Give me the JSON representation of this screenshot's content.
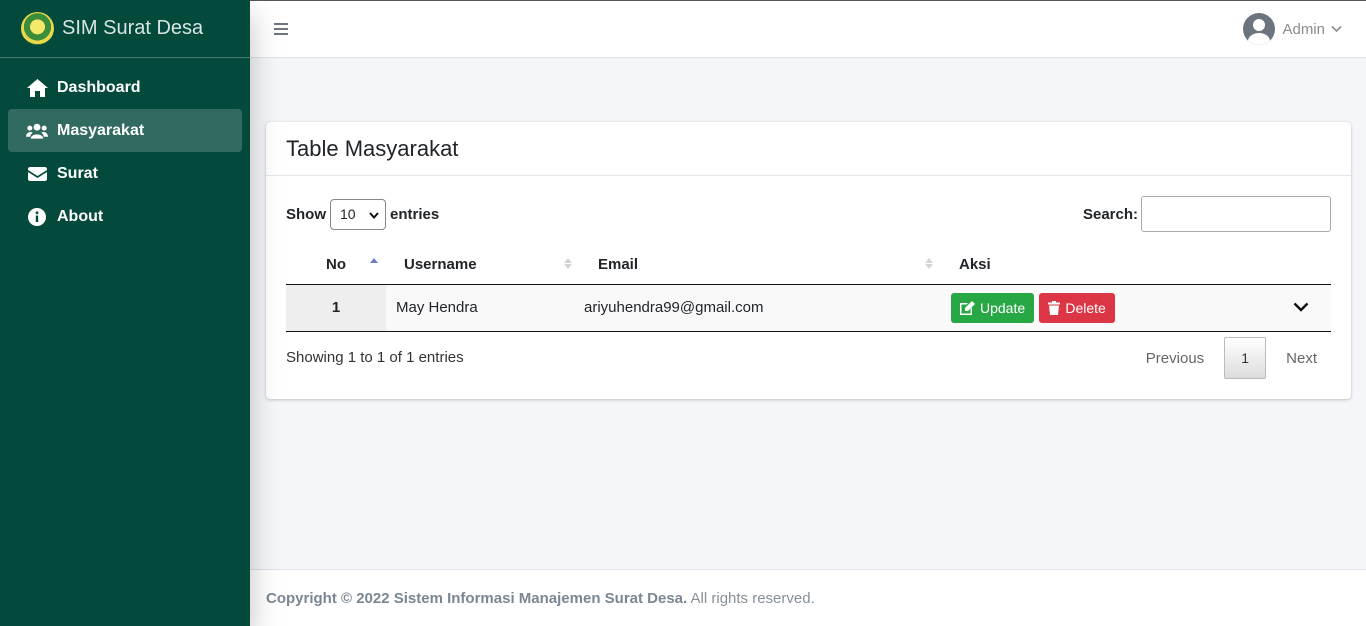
{
  "brand": {
    "title": "SIM Surat Desa"
  },
  "sidebar": {
    "items": [
      {
        "label": "Dashboard",
        "icon": "home-icon"
      },
      {
        "label": "Masyarakat",
        "icon": "users-icon",
        "active": true
      },
      {
        "label": "Surat",
        "icon": "envelope-icon"
      },
      {
        "label": "About",
        "icon": "info-circle-icon"
      }
    ]
  },
  "topbar": {
    "user_name": "Admin"
  },
  "card": {
    "title": "Table Masyarakat",
    "show_label": "Show",
    "entries_label": "entries",
    "page_size": "10",
    "search_label": "Search:",
    "search_value": ""
  },
  "table": {
    "columns": [
      "No",
      "Username",
      "Email",
      "Aksi"
    ],
    "rows": [
      {
        "no": "1",
        "username": "May Hendra",
        "email": "ariyuhendra99@gmail.com"
      }
    ],
    "update_label": "Update",
    "delete_label": "Delete"
  },
  "pagination": {
    "info": "Showing 1 to 1 of 1 entries",
    "previous": "Previous",
    "current": "1",
    "next": "Next"
  },
  "footer": {
    "copyright": "Copyright © 2022 Sistem Informasi Manajemen Surat Desa.",
    "rights": " All rights reserved."
  },
  "colors": {
    "sidebar": "#044a3c",
    "update": "#28a745",
    "delete": "#dc3545"
  }
}
